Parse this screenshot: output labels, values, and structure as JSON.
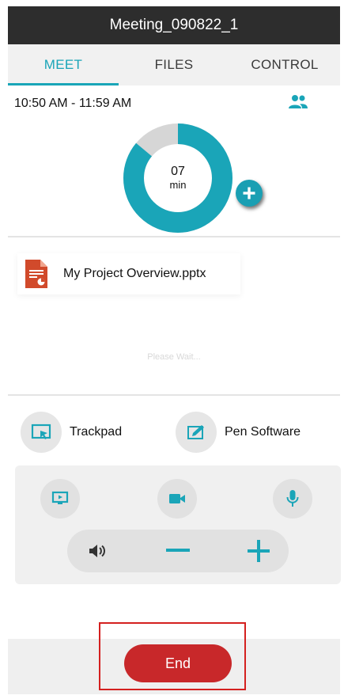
{
  "header": {
    "title": "Meeting_090822_1"
  },
  "tabs": [
    {
      "label": "MEET",
      "active": true
    },
    {
      "label": "FILES",
      "active": false
    },
    {
      "label": "CONTROL",
      "active": false
    }
  ],
  "meet": {
    "time_range": "10:50 AM - 11:59 AM",
    "timer_value": "07",
    "timer_unit": "min",
    "timer_ring_progress": 0.86,
    "participants_icon": "people-icon",
    "add_time_icon": "plus-icon"
  },
  "file": {
    "name": "My Project Overview.pptx",
    "icon": "pptx-file-icon",
    "status": "Please Wait..."
  },
  "control": {
    "trackpad_label": "Trackpad",
    "pen_label": "Pen Software",
    "icons": [
      "screen-share-icon",
      "camera-icon",
      "microphone-icon",
      "speaker-icon",
      "minus-icon",
      "plus-icon"
    ]
  },
  "footer": {
    "end_label": "End"
  },
  "colors": {
    "accent": "#1aa5b8",
    "end_button": "#c8282a",
    "header_bg": "#2d2d2d",
    "ring_remaining": "#d6d6d6"
  }
}
